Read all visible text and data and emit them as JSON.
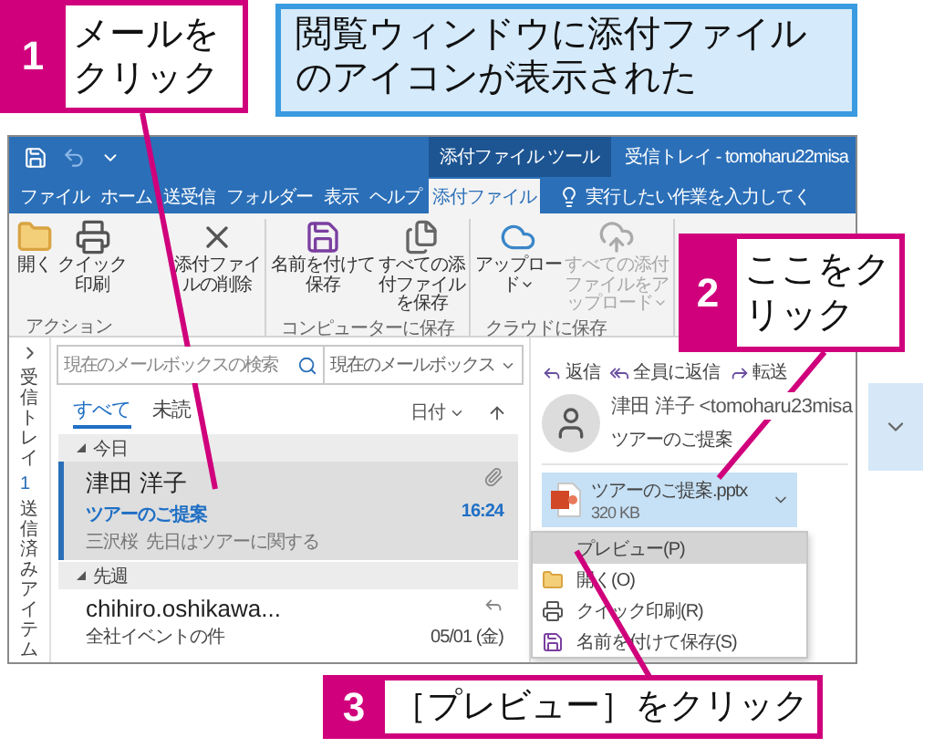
{
  "callouts": [
    {
      "number": "1",
      "text": "メールをクリック"
    },
    {
      "number": "2",
      "text": "ここをクリック"
    },
    {
      "number": "3",
      "text": "［プレビュー］をクリック"
    }
  ],
  "note": {
    "text": "閲覧ウィンドウに添付ファイルのアイコンが表示された"
  },
  "title_bar": {
    "context_tab": "添付ファイル ツール",
    "title": "受信トレイ - tomoharu22misa"
  },
  "ribbon_tabs": [
    {
      "label": "ファイル",
      "selected": false
    },
    {
      "label": "ホーム",
      "selected": false
    },
    {
      "label": "送受信",
      "selected": false
    },
    {
      "label": "フォルダー",
      "selected": false
    },
    {
      "label": "表示",
      "selected": false
    },
    {
      "label": "ヘルプ",
      "selected": false
    },
    {
      "label": "添付ファイル",
      "selected": true
    }
  ],
  "tell_me": {
    "placeholder": "実行したい作業を入力してく"
  },
  "ribbon_groups": [
    {
      "label": "アクション",
      "buttons": [
        {
          "kind": "open",
          "label": "開く",
          "disabled": false,
          "dropdown": false
        },
        {
          "kind": "print",
          "label": "クイック印刷",
          "disabled": false,
          "dropdown": false
        },
        {
          "kind": "delete",
          "label": "添付ファイルの削除",
          "disabled": false,
          "dropdown": false
        }
      ]
    },
    {
      "label": "コンピューターに保存",
      "buttons": [
        {
          "kind": "save-as",
          "label": "名前を付けて保存",
          "disabled": false,
          "dropdown": false
        },
        {
          "kind": "save-all",
          "label": "すべての添付ファイルを保存",
          "disabled": false,
          "dropdown": false
        }
      ]
    },
    {
      "label": "クラウドに保存",
      "buttons": [
        {
          "kind": "upload",
          "label": "アップロード",
          "disabled": false,
          "dropdown": true
        },
        {
          "kind": "upload-all",
          "label": "すべての添付ファイルをアップロード",
          "disabled": true,
          "dropdown": true
        }
      ]
    }
  ],
  "nav_pane": {
    "items": [
      {
        "label": "受信トレイ",
        "count": "1"
      },
      {
        "label": "送信済みアイテム"
      }
    ]
  },
  "message_list": {
    "search": {
      "placeholder": "現在のメールボックスの検索"
    },
    "scope": "現在のメールボックス",
    "filters": [
      {
        "label": "すべて",
        "selected": true
      },
      {
        "label": "未読",
        "selected": false
      }
    ],
    "sort": "日付",
    "groups": [
      {
        "label": "今日",
        "messages": [
          {
            "sender": "津田 洋子",
            "subject": "ツアーのご提案",
            "time": "16:24",
            "preview": "三沢桜  先日はツアーに関する",
            "attachment": true,
            "replied": false,
            "unread": true,
            "selected": true
          }
        ]
      },
      {
        "label": "先週",
        "messages": [
          {
            "sender": "chihiro.oshikawa...",
            "subject": "全社イベントの件",
            "time": "05/01 (金)",
            "attachment": false,
            "replied": true,
            "unread": false,
            "selected": false
          }
        ]
      }
    ]
  },
  "reading_pane": {
    "actions": [
      {
        "kind": "reply",
        "label": "返信"
      },
      {
        "kind": "reply-all",
        "label": "全員に返信"
      },
      {
        "kind": "forward",
        "label": "転送"
      }
    ],
    "sender": "津田 洋子 <tomoharu23misa",
    "subject": "ツアーのご提案",
    "attachment": {
      "name": "ツアーのご提案.pptx",
      "size": "320 KB",
      "selected": true
    },
    "menu": [
      {
        "kind": "none",
        "label": "プレビュー(P)",
        "selected": true
      },
      {
        "kind": "folder",
        "label": "開く(O)",
        "selected": false
      },
      {
        "kind": "printer",
        "label": "クイック印刷(R)",
        "selected": false
      },
      {
        "kind": "save",
        "label": "名前を付けて保存(S)",
        "selected": false
      }
    ]
  }
}
